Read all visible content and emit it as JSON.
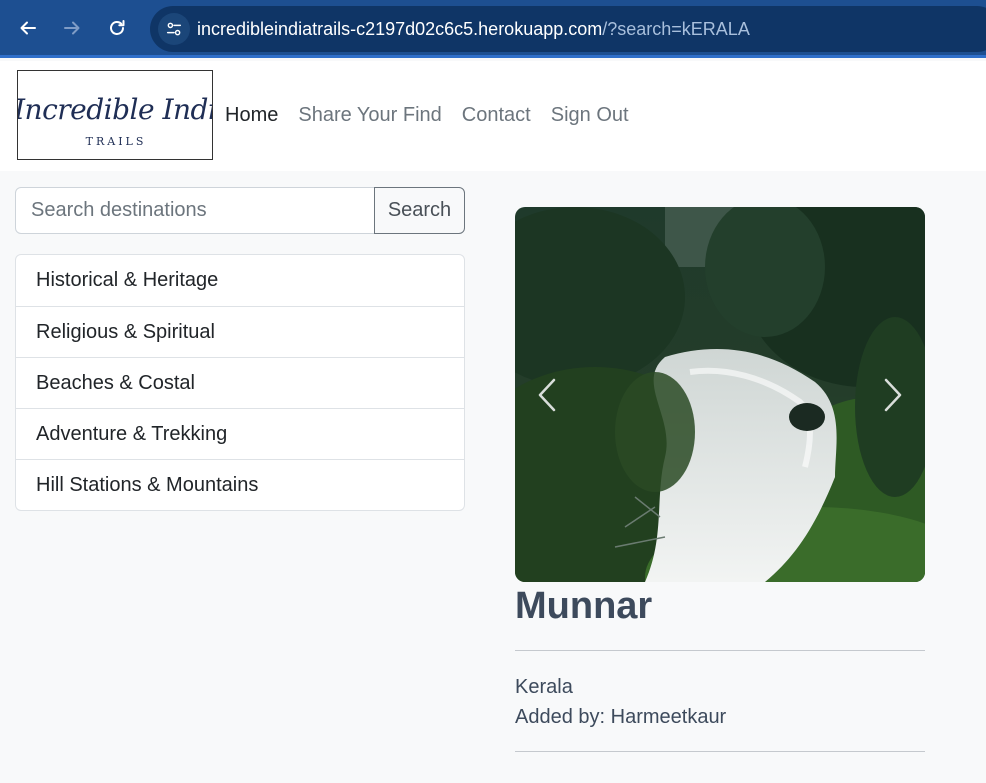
{
  "browser": {
    "url_host": "incredibleindiatrails-c2197d02c6c5.herokuapp.com",
    "url_path": "/?search=kERALA"
  },
  "site": {
    "logo_script": "Incredible India",
    "logo_sub": "TRAILS",
    "nav": [
      {
        "label": "Home",
        "active": true
      },
      {
        "label": "Share Your Find",
        "active": false
      },
      {
        "label": "Contact",
        "active": false
      },
      {
        "label": "Sign Out",
        "active": false
      }
    ]
  },
  "search": {
    "placeholder": "Search destinations",
    "value": "",
    "button_label": "Search"
  },
  "categories": [
    "Historical & Heritage",
    "Religious & Spiritual",
    "Beaches & Costal",
    "Adventure & Trekking",
    "Hill Stations & Mountains"
  ],
  "destination": {
    "name": "Munnar",
    "state": "Kerala",
    "added_by": "Added by: Harmeetkaur",
    "image_icon": "waterfall-photo"
  },
  "colors": {
    "browser_bar": "#1d4f91",
    "url_box": "#0f3566",
    "page_bg": "#f8f9fa",
    "title_text": "#3d4a5c"
  }
}
